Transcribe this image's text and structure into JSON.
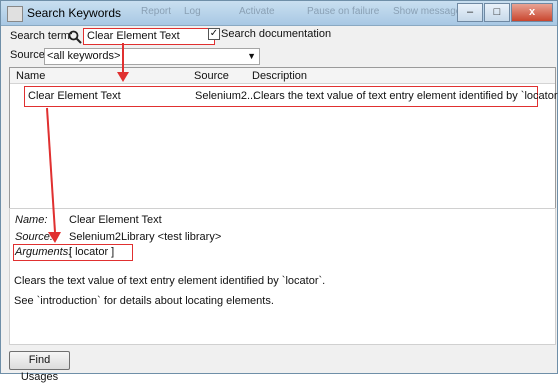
{
  "window": {
    "title": "Search Keywords",
    "background_menu": [
      "Report",
      "Log",
      "Activate",
      "Pause on failure",
      "Show message log"
    ],
    "buttons": {
      "minimize": "–",
      "maximize": "□",
      "close": "x"
    }
  },
  "search": {
    "label": "Search term:",
    "value": "Clear Element Text",
    "checkbox_label": "Search documentation",
    "checkbox_checked": true
  },
  "source": {
    "label": "Source:",
    "selected": "<all keywords>"
  },
  "table": {
    "columns": [
      "Name",
      "Source",
      "Description"
    ],
    "rows": [
      {
        "name": "Clear Element Text",
        "source": "Selenium2...",
        "description": "Clears the text value of text entry element identified by `locator`."
      }
    ]
  },
  "details": {
    "name_label": "Name:",
    "name_value": "Clear Element Text",
    "source_label": "Source:",
    "source_value": "Selenium2Library <test library>",
    "arguments_label": "Arguments:",
    "arguments_value": "[ locator ]",
    "description_1": "Clears the text value of text entry element identified by `locator`.",
    "description_2": "See `introduction` for details about locating elements."
  },
  "footer": {
    "find_usages_label": "Find Usages"
  },
  "colors": {
    "annotation_red": "#e03030"
  }
}
